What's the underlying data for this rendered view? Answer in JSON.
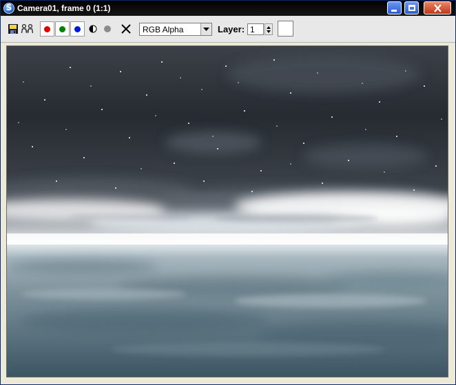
{
  "window": {
    "title": "Camera01, frame 0 (1:1)",
    "app_icon_glyph": "S"
  },
  "controls": {
    "minimize": "minimize-icon",
    "maximize": "maximize-icon",
    "close": "close-icon"
  },
  "toolbar": {
    "channel_select": {
      "value": "RGB Alpha"
    },
    "layer": {
      "label": "Layer:",
      "value": "1"
    },
    "channel_colors": {
      "red": "#e00000",
      "green": "#008000",
      "blue": "#0018d8"
    },
    "icons": [
      "save-icon",
      "clone-icon",
      "red-channel-icon",
      "green-channel-icon",
      "blue-channel-icon",
      "monochrome-icon",
      "alpha-icon",
      "clear-icon"
    ]
  }
}
